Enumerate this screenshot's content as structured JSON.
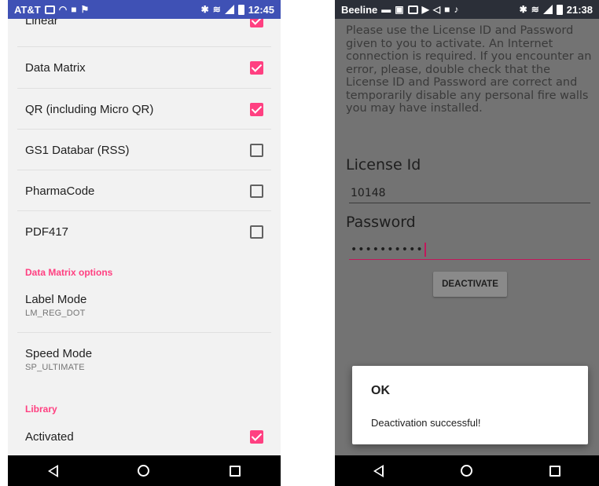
{
  "left": {
    "status": {
      "carrier": "AT&T",
      "time": "12:45"
    },
    "partial_row": "Linear",
    "rows": [
      {
        "title": "Data Matrix",
        "checked": true
      },
      {
        "title": "QR (including Micro QR)",
        "checked": true
      },
      {
        "title": "GS1 Databar (RSS)",
        "checked": false
      },
      {
        "title": "PharmaCode",
        "checked": false
      },
      {
        "title": "PDF417",
        "checked": false
      }
    ],
    "section_dm": "Data Matrix options",
    "label_mode": {
      "title": "Label Mode",
      "value": "LM_REG_DOT"
    },
    "speed_mode": {
      "title": "Speed Mode",
      "value": "SP_ULTIMATE"
    },
    "section_lib": "Library",
    "activated": {
      "title": "Activated",
      "checked": true
    }
  },
  "right": {
    "status": {
      "carrier": "Beeline",
      "time": "21:38"
    },
    "info_text": "Please use the License ID and Password given to you to activate. An Internet connection is required. If you encounter an error, please, double check that the License ID and Password are correct and temporarily disable any personal fire walls you may have installed.",
    "license_label": "License Id",
    "license_value": "10148",
    "password_label": "Password",
    "password_value": "••••••••••",
    "button_label": "DEACTIVATE",
    "dialog": {
      "title": "OK",
      "message": "Deactivation successful!"
    }
  },
  "colors": {
    "accent": "#ff4081",
    "status_bar_left": "#3f51b5",
    "dim_background": "#737373"
  }
}
